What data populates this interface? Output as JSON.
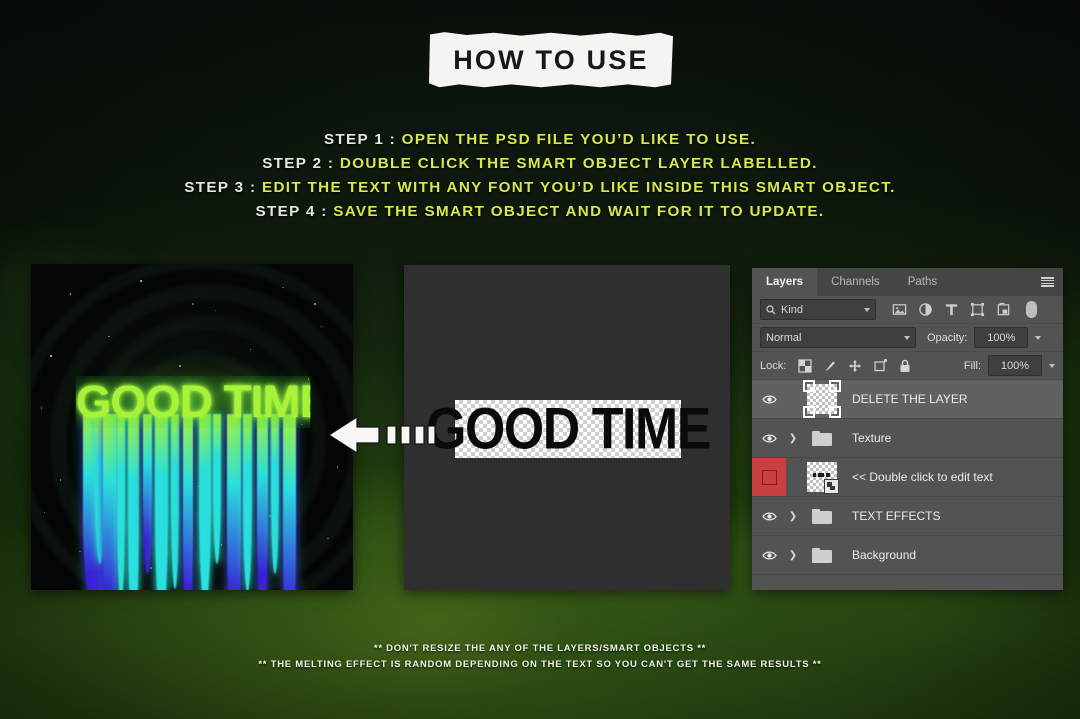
{
  "title_banner": {
    "text": "HOW TO USE"
  },
  "steps": [
    {
      "label": "STEP 1 :",
      "body": "OPEN THE PSD FILE YOU’D LIKE TO USE."
    },
    {
      "label": "STEP 2 :",
      "body": "DOUBLE CLICK THE SMART OBJECT LAYER LABELLED."
    },
    {
      "label": "STEP 3 :",
      "body": "EDIT THE TEXT WITH ANY FONT YOU’D LIKE INSIDE THIS SMART OBJECT."
    },
    {
      "label": "STEP 4 :",
      "body": "SAVE THE SMART OBJECT AND WAIT FOR IT TO UPDATE."
    }
  ],
  "artwork": {
    "word": "GOOD TIME",
    "description": "neon melting drip text on dark space background"
  },
  "canvas": {
    "word": "GOOD TIME"
  },
  "arrow": {
    "direction": "left",
    "dash_count": 4
  },
  "photoshop_panel": {
    "tabs": [
      {
        "label": "Layers",
        "active": true
      },
      {
        "label": "Channels",
        "active": false
      },
      {
        "label": "Paths",
        "active": false
      }
    ],
    "menu_icon": "hamburger-menu-icon",
    "filter": {
      "search_icon": "search-icon",
      "kind_label": "Kind",
      "icons": [
        "image-filter-icon",
        "adjustment-filter-icon",
        "type-filter-icon",
        "shape-filter-icon",
        "smart-object-filter-icon"
      ],
      "toggle": "filter-toggle-pill"
    },
    "blend_mode": "Normal",
    "opacity_label": "Opacity:",
    "opacity_value": "100%",
    "lock_label": "Lock:",
    "lock_icons": [
      "lock-transparent-pixels-icon",
      "lock-image-pixels-icon",
      "lock-position-icon",
      "lock-artboard-nesting-icon",
      "lock-all-icon"
    ],
    "fill_label": "Fill:",
    "fill_value": "100%",
    "layers": [
      {
        "name": "DELETE THE LAYER",
        "visible": true,
        "selected": true,
        "type": "pixel",
        "has_expand": false,
        "highlight": "none"
      },
      {
        "name": "Texture",
        "visible": true,
        "selected": false,
        "type": "group",
        "has_expand": true,
        "highlight": "none"
      },
      {
        "name": "<< Double click to edit text",
        "visible": false,
        "selected": false,
        "type": "smart-object",
        "has_expand": false,
        "highlight": "red"
      },
      {
        "name": "TEXT EFFECTS",
        "visible": true,
        "selected": false,
        "type": "group",
        "has_expand": true,
        "highlight": "none"
      },
      {
        "name": "Background",
        "visible": true,
        "selected": false,
        "type": "group",
        "has_expand": true,
        "highlight": "none"
      }
    ]
  },
  "notes": [
    "** DON'T RESIZE THE ANY OF THE LAYERS/SMART OBJECTS **",
    "** THE MELTING EFFECT IS RANDOM DEPENDING ON THE TEXT SO YOU CAN'T GET THE SAME RESULTS **"
  ],
  "colors": {
    "accent_yellow_green": "#d8e84a",
    "step_label": "#e3e9e2",
    "tape_bg": "#f4f5f3",
    "panel_bg": "#535353",
    "panel_tabbar": "#454545",
    "selected_row": "#616161",
    "red_highlight": "#c8413f",
    "canvas_bg": "#2f2f2f",
    "neon_green": "#a8f33a",
    "neon_cyan": "#2ae0e0",
    "neon_blue": "#3a20d8"
  }
}
